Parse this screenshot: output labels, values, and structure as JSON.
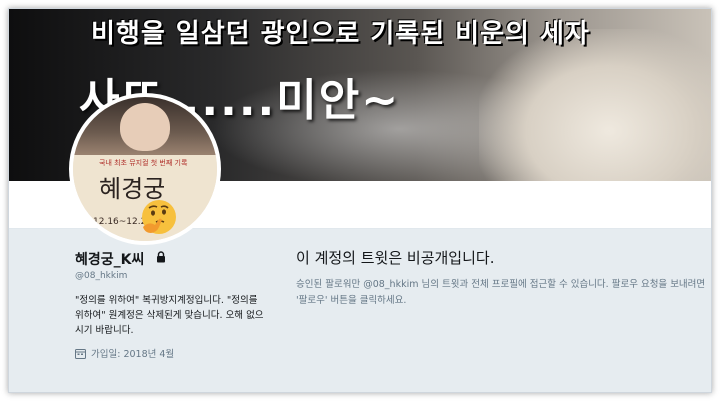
{
  "banner": {
    "title": "비행을 일삼던 광인으로 기록된 비운의 세자",
    "subtitle": "사또......미안~"
  },
  "avatar": {
    "poster_tag": "국내 최초 뮤지컬 첫 번째 기록",
    "poster_title": "혜경궁",
    "poster_date": "12.16~12.28"
  },
  "profile": {
    "name": "혜경궁_K씨",
    "handle": "@08_hkkim",
    "bio": "\"정의를 위하여\" 복귀방지계정입니다. \"정의를 위하여\" 원계정은 삭제된게 맞습니다. 오해 없으시기 바랍니다.",
    "joined": "가입일: 2018년 4월"
  },
  "private_notice": {
    "heading": "이 계정의 트윗은 비공개입니다.",
    "description": "승인된 팔로워만 @08_hkkim 님의 트윗과 전체 프로필에 접근할 수 있습니다. 팔로우 요청을 보내려면 '팔로우' 버튼을 클릭하세요."
  },
  "colors": {
    "page_bg": "#e6ecf0",
    "primary_text": "#14171a",
    "secondary_text": "#657786"
  },
  "icons": {
    "lock": "lock-icon",
    "calendar": "calendar-icon",
    "emoji": "thinking-face-icon"
  }
}
